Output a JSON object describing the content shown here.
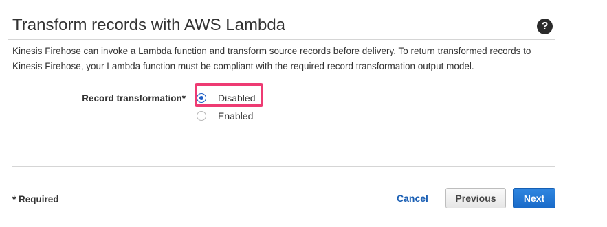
{
  "section": {
    "title": "Transform records with AWS Lambda",
    "help_icon": "question-circle-icon",
    "help_symbol": "?",
    "description": "Kinesis Firehose can invoke a Lambda function and transform source records before delivery. To return transformed records to Kinesis Firehose, your Lambda function must be compliant with the required record transformation output model."
  },
  "record_transformation": {
    "label": "Record transformation*",
    "options": [
      {
        "label": "Disabled",
        "selected": true
      },
      {
        "label": "Enabled",
        "selected": false
      }
    ],
    "highlight_color": "#ee3b73"
  },
  "footer": {
    "required_note": "* Required",
    "cancel_label": "Cancel",
    "previous_label": "Previous",
    "next_label": "Next"
  },
  "colors": {
    "link": "#1a5fb4",
    "primary_button": "#1a6bc9",
    "radio_selected": "#1e5fc7"
  }
}
